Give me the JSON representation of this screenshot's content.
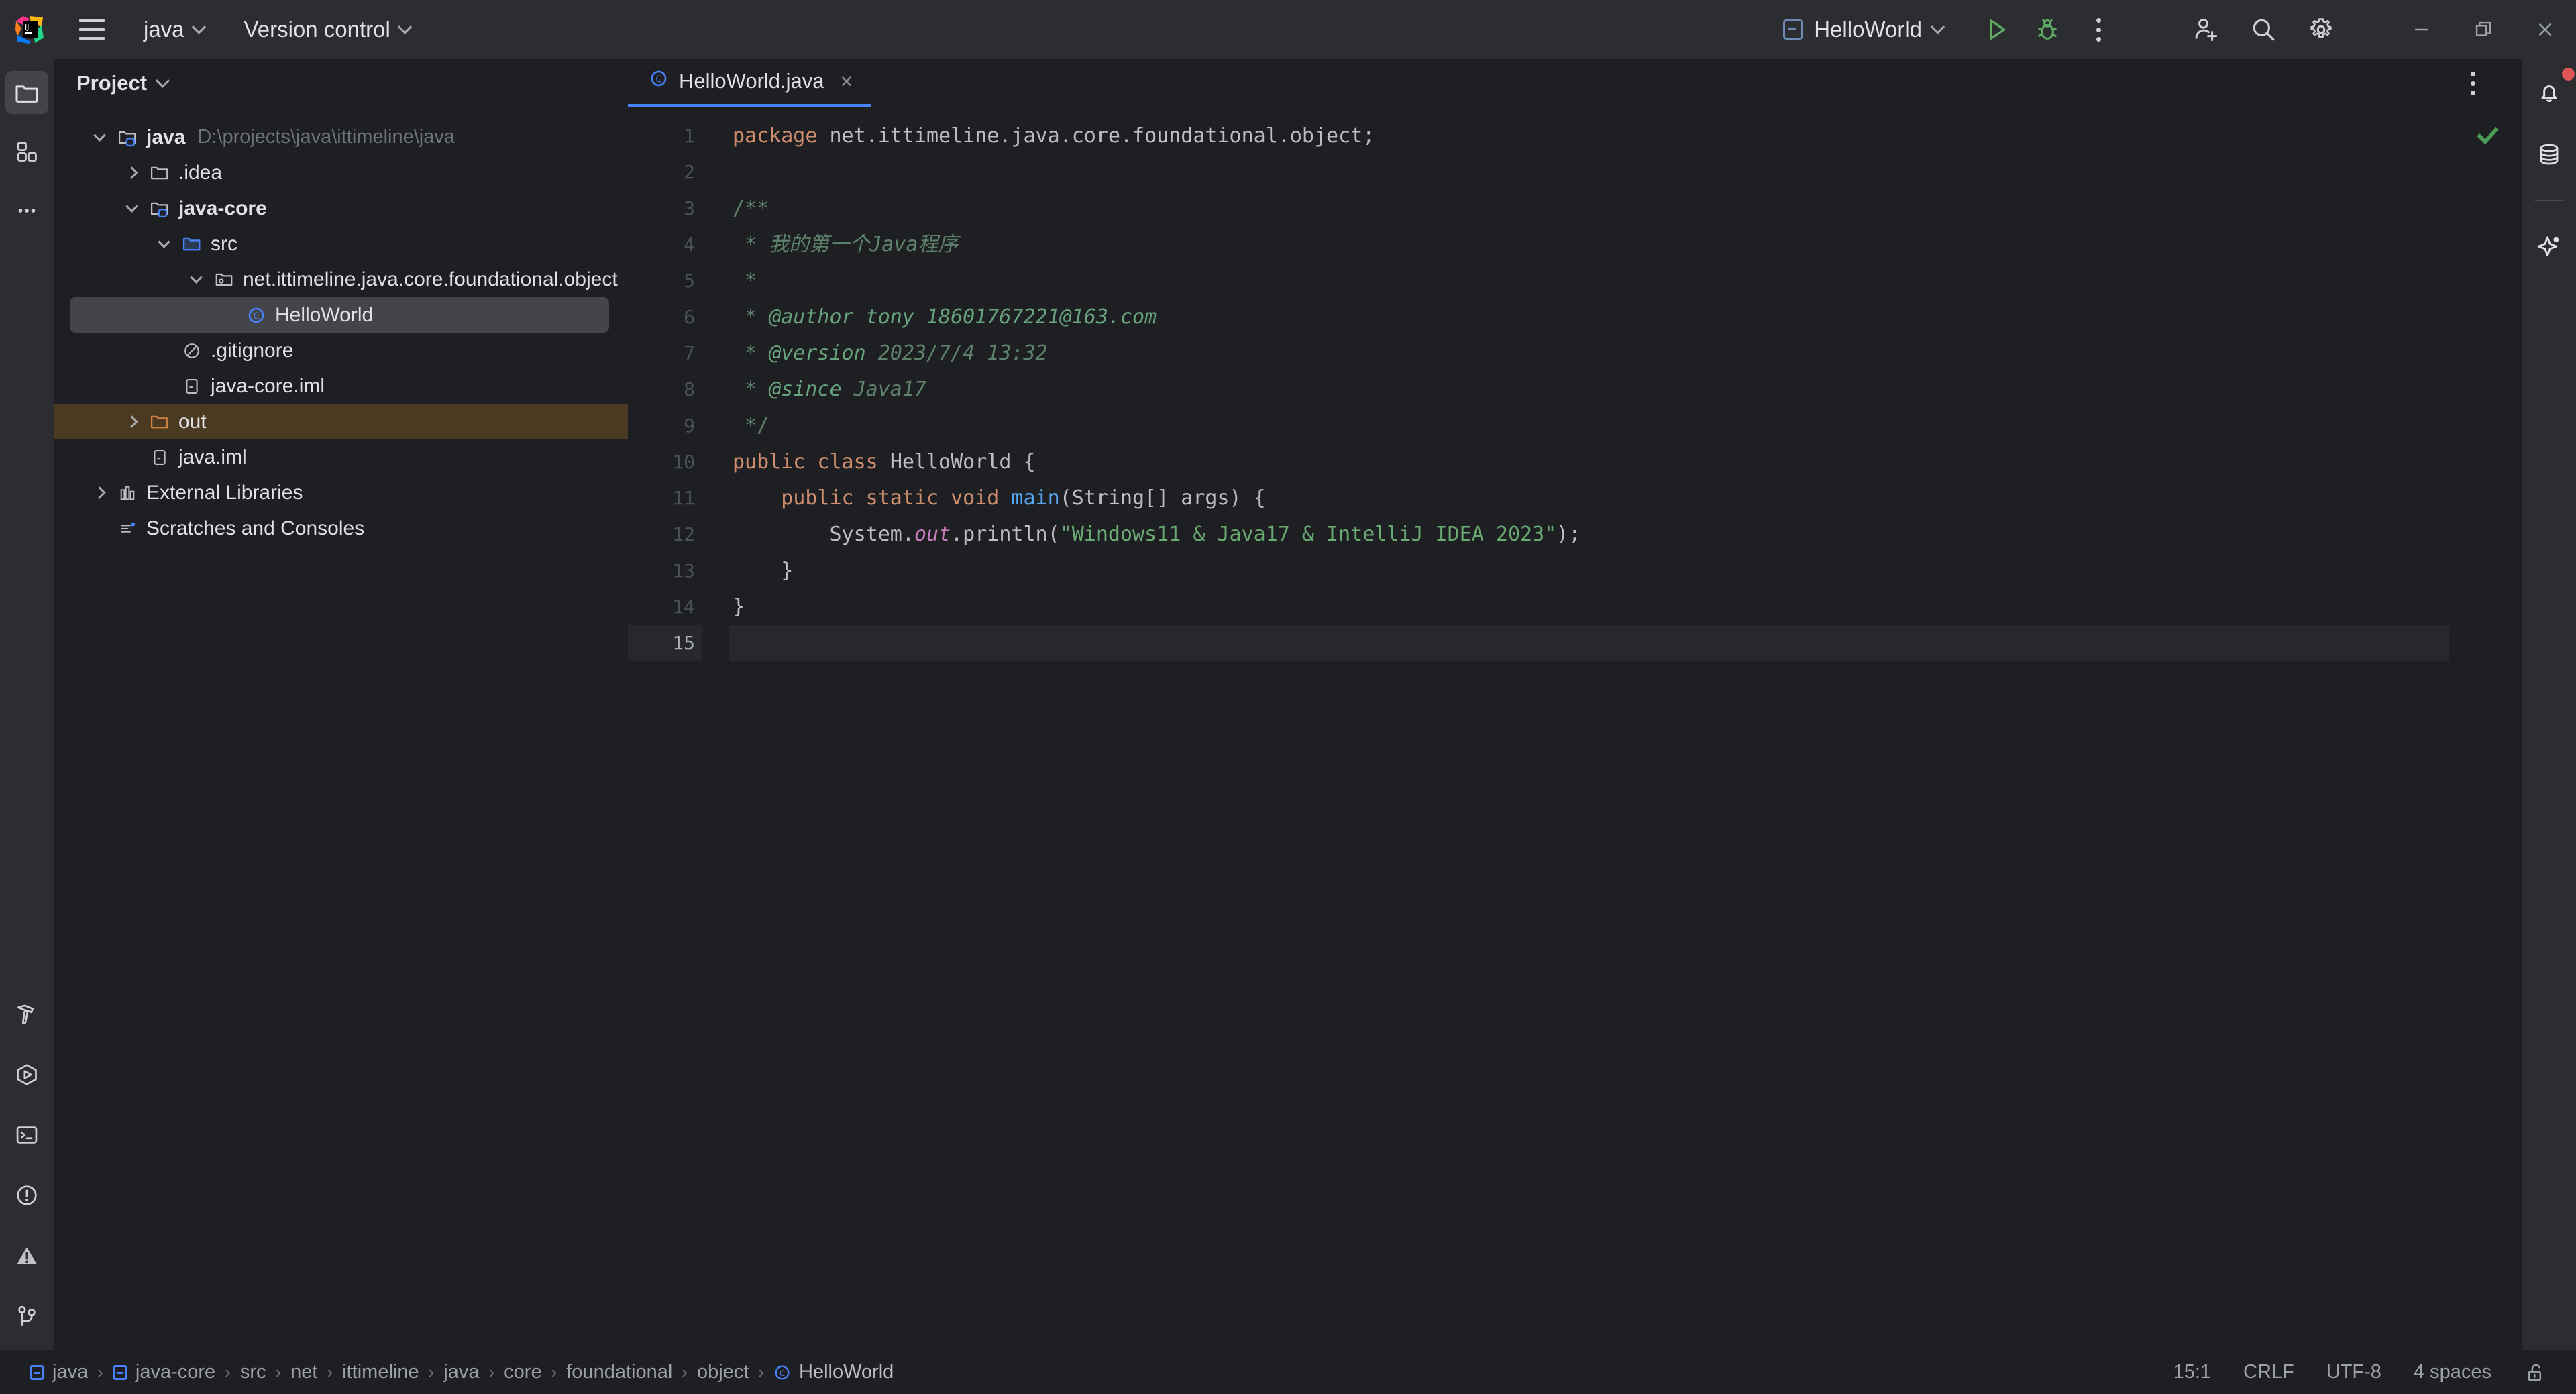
{
  "titlebar": {
    "logo": "intellij-logo",
    "menu_icon": "hamburger-menu-icon",
    "project_name": "java",
    "version_control": "Version control",
    "run_config": "HelloWorld",
    "run_label": "Run",
    "debug_label": "Debug",
    "more_label": "More",
    "add_user_label": "Add user",
    "search_label": "Search",
    "settings_label": "Settings",
    "minimize_label": "Minimize",
    "maximize_label": "Maximize",
    "close_label": "Close"
  },
  "left_rail": {
    "top": [
      {
        "name": "project-tool-window",
        "icon": "folder-icon",
        "active": true
      },
      {
        "name": "structure-tool-window",
        "icon": "blocks-icon",
        "active": false
      },
      {
        "name": "more-tool-windows",
        "icon": "ellipsis-icon",
        "active": false
      }
    ],
    "bottom": [
      {
        "name": "build-tool-window",
        "icon": "hammer-icon"
      },
      {
        "name": "run-tool-window",
        "icon": "run-hexagon-icon"
      },
      {
        "name": "terminal-tool-window",
        "icon": "terminal-icon"
      },
      {
        "name": "problems-tool-window",
        "icon": "exclamation-circle-icon"
      },
      {
        "name": "warnings-indicator",
        "icon": "warning-triangle-icon"
      },
      {
        "name": "version-control-tool-window",
        "icon": "git-branch-icon"
      }
    ]
  },
  "project_panel": {
    "title": "Project",
    "tree": [
      {
        "label": "java",
        "path": "D:\\projects\\java\\ittimeline\\java",
        "icon": "module-folder-icon",
        "depth": 0,
        "twist": "open",
        "bold": true
      },
      {
        "label": ".idea",
        "path": "",
        "icon": "folder-icon",
        "depth": 1,
        "twist": "closed",
        "bold": false
      },
      {
        "label": "java-core",
        "path": "",
        "icon": "module-folder-icon",
        "depth": 1,
        "twist": "open",
        "bold": true
      },
      {
        "label": "src",
        "path": "",
        "icon": "source-folder-icon",
        "depth": 2,
        "twist": "open",
        "bold": false
      },
      {
        "label": "net.ittimeline.java.core.foundational.object",
        "path": "",
        "icon": "package-icon",
        "depth": 3,
        "twist": "open",
        "bold": false
      },
      {
        "label": "HelloWorld",
        "path": "",
        "icon": "java-class-icon",
        "depth": 4,
        "twist": "none",
        "bold": false,
        "selected": true
      },
      {
        "label": ".gitignore",
        "path": "",
        "icon": "gitignore-icon",
        "depth": 2,
        "twist": "none",
        "bold": false
      },
      {
        "label": "java-core.iml",
        "path": "",
        "icon": "iml-file-icon",
        "depth": 2,
        "twist": "none",
        "bold": false
      },
      {
        "label": "out",
        "path": "",
        "icon": "excluded-folder-icon",
        "depth": 1,
        "twist": "closed",
        "bold": false,
        "excluded": true
      },
      {
        "label": "java.iml",
        "path": "",
        "icon": "iml-file-icon",
        "depth": 1,
        "twist": "none",
        "bold": false
      },
      {
        "label": "External Libraries",
        "path": "",
        "icon": "libraries-icon",
        "depth": 0,
        "twist": "closed",
        "bold": false
      },
      {
        "label": "Scratches and Consoles",
        "path": "",
        "icon": "scratches-icon",
        "depth": 0,
        "twist": "none",
        "bold": false
      }
    ]
  },
  "editor": {
    "tab": {
      "label": "HelloWorld.java",
      "icon": "java-class-icon",
      "close": "×"
    },
    "tabbar_more": "editor-options",
    "inspection_status": "no-problems-check",
    "current_line": 15,
    "run_gutter_lines": [
      10,
      11
    ],
    "lines": [
      {
        "n": 1,
        "text": "package net.ittimeline.java.core.foundational.object;"
      },
      {
        "n": 2,
        "text": ""
      },
      {
        "n": 3,
        "text": "/**"
      },
      {
        "n": 4,
        "text": " * 我的第一个Java程序"
      },
      {
        "n": 5,
        "text": " *"
      },
      {
        "n": 6,
        "text": " * @author tony 18601767221@163.com"
      },
      {
        "n": 7,
        "text": " * @version 2023/7/4 13:32"
      },
      {
        "n": 8,
        "text": " * @since Java17"
      },
      {
        "n": 9,
        "text": " */"
      },
      {
        "n": 10,
        "text": "public class HelloWorld {"
      },
      {
        "n": 11,
        "text": "    public static void main(String[] args) {"
      },
      {
        "n": 12,
        "text": "        System.out.println(\"Windows11 & Java17 & IntelliJ IDEA 2023\");"
      },
      {
        "n": 13,
        "text": "    }"
      },
      {
        "n": 14,
        "text": "}"
      },
      {
        "n": 15,
        "text": ""
      }
    ]
  },
  "right_rail": [
    {
      "name": "notifications",
      "icon": "bell-icon",
      "badge": true
    },
    {
      "name": "database-tool-window",
      "icon": "database-icon",
      "badge": false
    },
    {
      "name": "ai-assistant",
      "icon": "sparkle-icon",
      "badge": false
    }
  ],
  "statusbar": {
    "breadcrumbs": [
      {
        "label": "java",
        "icon": "module-icon"
      },
      {
        "label": "java-core",
        "icon": "module-icon"
      },
      {
        "label": "src",
        "icon": ""
      },
      {
        "label": "net",
        "icon": ""
      },
      {
        "label": "ittimeline",
        "icon": ""
      },
      {
        "label": "java",
        "icon": ""
      },
      {
        "label": "core",
        "icon": ""
      },
      {
        "label": "foundational",
        "icon": ""
      },
      {
        "label": "object",
        "icon": ""
      },
      {
        "label": "HelloWorld",
        "icon": "java-class-icon"
      }
    ],
    "separator": "›",
    "caret_position": "15:1",
    "line_separator": "CRLF",
    "encoding": "UTF-8",
    "indent": "4 spaces",
    "lock_icon": "unlocked-padlock-icon"
  },
  "colors": {
    "accent": "#4682FA",
    "run_green": "#499C54",
    "keyword": "#CF8E6D",
    "string": "#6AAB73",
    "doc_comment": "#5F826B",
    "excluded": "#4A3A22",
    "badge_red": "#E05555"
  }
}
